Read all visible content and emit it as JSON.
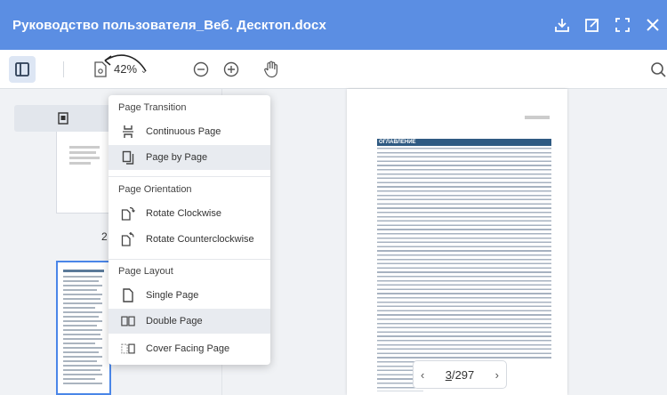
{
  "window": {
    "title": "Руководство пользователя_Веб. Десктоп.docx"
  },
  "toolbar": {
    "zoom": "42%"
  },
  "pager": {
    "current": "3",
    "separator": "/",
    "total": "297"
  },
  "left_panel": {
    "visible_page_label": "2"
  },
  "document_page": {
    "toc_title": "ОГЛАВЛЕНИЕ"
  },
  "menu": {
    "transition_heading": "Page Transition",
    "transition_items": [
      {
        "label": "Continuous Page",
        "selected": false
      },
      {
        "label": "Page by Page",
        "selected": true
      }
    ],
    "orientation_heading": "Page Orientation",
    "orientation_items": [
      {
        "label": "Rotate Clockwise"
      },
      {
        "label": "Rotate Counterclockwise"
      }
    ],
    "layout_heading": "Page Layout",
    "layout_items": [
      {
        "label": "Single Page",
        "selected": false
      },
      {
        "label": "Double Page",
        "selected": true
      },
      {
        "label": "Cover Facing Page",
        "selected": false
      }
    ]
  },
  "colors": {
    "titlebar": "#5b8ee3",
    "panel_bg": "#f0f2f5",
    "selected_item": "#e8ebf0",
    "toc_header": "#2f5a82"
  }
}
